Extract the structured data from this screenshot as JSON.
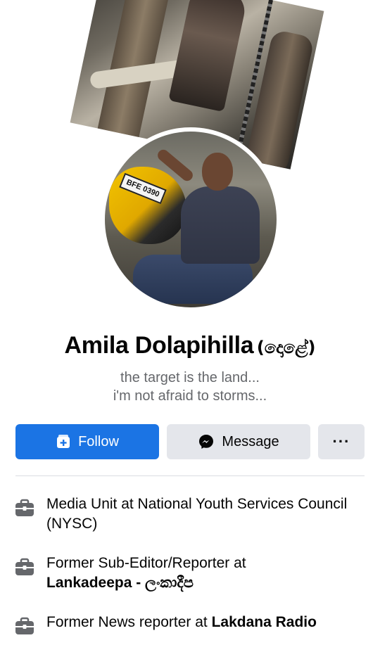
{
  "profile": {
    "name": "Amila Dolapihilla",
    "nickname": "(දොළේ)",
    "bio_line1": "the target is the land...",
    "bio_line2": "i'm not afraid to storms...",
    "plate_text": "BFE 0390"
  },
  "actions": {
    "follow_label": "Follow",
    "message_label": "Message",
    "more_label": "···"
  },
  "info": [
    {
      "text_before": "Media Unit at National Youth Services Council (NYSC)",
      "bold": ""
    },
    {
      "text_before": "Former Sub-Editor/Reporter at ",
      "bold": "Lankadeepa - ලංකාදීප"
    },
    {
      "text_before": "Former News reporter at ",
      "bold": "Lakdana Radio"
    }
  ],
  "colors": {
    "primary_button": "#1b74e4",
    "secondary_button": "#e4e6eb",
    "secondary_text": "#65676b",
    "icon": "#65676b"
  },
  "icons": {
    "follow": "follow-plus-icon",
    "message": "messenger-icon",
    "work": "briefcase-icon"
  }
}
